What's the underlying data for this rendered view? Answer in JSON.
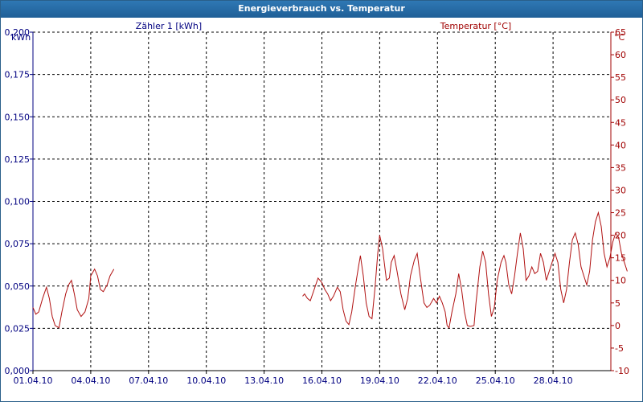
{
  "window": {
    "title": "Energieverbrauch vs. Temperatur"
  },
  "chart_data": {
    "type": "line",
    "title": "Energieverbrauch vs. Temperatur",
    "grid": true,
    "colors": {
      "left_axis": "#000080",
      "right_axis": "#a00000",
      "temperature_line": "#b01010",
      "grid": "#000000"
    },
    "left_axis": {
      "unit": "kWh",
      "series_label": "Zähler 1 [kWh]",
      "range": [
        0,
        0.2
      ],
      "ticks": [
        "0,000",
        "0,025",
        "0,050",
        "0,075",
        "0,100",
        "0,125",
        "0,150",
        "0,175",
        "0,200"
      ]
    },
    "right_axis": {
      "unit": "°C",
      "series_label": "Temperatur [°C]",
      "range": [
        -10,
        65
      ],
      "ticks": [
        "-10",
        "-5",
        "0",
        "5",
        "10",
        "15",
        "20",
        "25",
        "30",
        "35",
        "40",
        "45",
        "50",
        "55",
        "60",
        "65"
      ]
    },
    "x_axis": {
      "range_days": [
        1,
        31
      ],
      "tick_days": [
        1,
        4,
        7,
        10,
        13,
        16,
        19,
        22,
        25,
        28
      ],
      "tick_labels": [
        "01.04.10",
        "04.04.10",
        "07.04.10",
        "10.04.10",
        "13.04.10",
        "16.04.10",
        "19.04.10",
        "22.04.10",
        "25.04.10",
        "28.04.10"
      ]
    },
    "series": [
      {
        "name": "Temperatur [°C]",
        "axis": "right",
        "segments": [
          [
            [
              1.0,
              4
            ],
            [
              1.15,
              2.5
            ],
            [
              1.3,
              3
            ],
            [
              1.5,
              6
            ],
            [
              1.7,
              8.5
            ],
            [
              1.85,
              6
            ],
            [
              2.0,
              2
            ],
            [
              2.15,
              0
            ],
            [
              2.35,
              -0.5
            ],
            [
              2.5,
              3
            ],
            [
              2.7,
              7
            ],
            [
              2.85,
              9
            ],
            [
              3.0,
              10
            ],
            [
              3.15,
              7
            ],
            [
              3.3,
              3.5
            ],
            [
              3.5,
              2
            ],
            [
              3.7,
              3
            ],
            [
              3.9,
              6
            ],
            [
              4.0,
              11
            ],
            [
              4.2,
              12.5
            ],
            [
              4.35,
              11
            ],
            [
              4.5,
              8
            ],
            [
              4.65,
              7.5
            ],
            [
              4.85,
              9
            ],
            [
              5.0,
              11
            ],
            [
              5.2,
              12.5
            ]
          ],
          [
            [
              15.0,
              6.5
            ],
            [
              15.1,
              7
            ],
            [
              15.25,
              6
            ],
            [
              15.4,
              5.5
            ],
            [
              15.6,
              8
            ],
            [
              15.8,
              10.5
            ],
            [
              16.0,
              9.5
            ],
            [
              16.15,
              8
            ],
            [
              16.3,
              7
            ],
            [
              16.45,
              5.5
            ],
            [
              16.6,
              6.5
            ],
            [
              16.8,
              8.5
            ],
            [
              16.95,
              7.5
            ],
            [
              17.1,
              3.5
            ],
            [
              17.25,
              1
            ],
            [
              17.4,
              0.2
            ],
            [
              17.55,
              3
            ],
            [
              17.75,
              9
            ],
            [
              17.9,
              13
            ],
            [
              18.0,
              15.5
            ],
            [
              18.15,
              11
            ],
            [
              18.3,
              5
            ],
            [
              18.45,
              2
            ],
            [
              18.6,
              1.5
            ],
            [
              18.75,
              8
            ],
            [
              18.9,
              16
            ],
            [
              19.0,
              20
            ],
            [
              19.15,
              17
            ],
            [
              19.35,
              10
            ],
            [
              19.5,
              10.5
            ],
            [
              19.6,
              14
            ],
            [
              19.75,
              15.5
            ],
            [
              19.9,
              12
            ],
            [
              20.1,
              7
            ],
            [
              20.3,
              3.5
            ],
            [
              20.45,
              6
            ],
            [
              20.6,
              11
            ],
            [
              20.8,
              14.5
            ],
            [
              20.95,
              16
            ],
            [
              21.1,
              11
            ],
            [
              21.3,
              5
            ],
            [
              21.45,
              4
            ],
            [
              21.6,
              4.5
            ],
            [
              21.8,
              6
            ],
            [
              21.95,
              5
            ],
            [
              22.1,
              6.5
            ],
            [
              22.25,
              5
            ],
            [
              22.4,
              3
            ],
            [
              22.5,
              0
            ],
            [
              22.6,
              -0.5
            ],
            [
              22.75,
              3
            ],
            [
              22.95,
              7
            ],
            [
              23.1,
              11.5
            ],
            [
              23.25,
              8
            ],
            [
              23.4,
              3
            ],
            [
              23.55,
              0
            ],
            [
              23.7,
              -0.2
            ],
            [
              23.9,
              0
            ],
            [
              24.0,
              5
            ],
            [
              24.2,
              13
            ],
            [
              24.35,
              16.5
            ],
            [
              24.5,
              14
            ],
            [
              24.65,
              7
            ],
            [
              24.8,
              2
            ],
            [
              24.95,
              4
            ],
            [
              25.1,
              10
            ],
            [
              25.3,
              14
            ],
            [
              25.45,
              15.5
            ],
            [
              25.55,
              14
            ],
            [
              25.7,
              9
            ],
            [
              25.85,
              7
            ],
            [
              26.0,
              11
            ],
            [
              26.15,
              16
            ],
            [
              26.3,
              20.5
            ],
            [
              26.45,
              17
            ],
            [
              26.6,
              10
            ],
            [
              26.75,
              11
            ],
            [
              26.9,
              13
            ],
            [
              27.05,
              11.5
            ],
            [
              27.2,
              12
            ],
            [
              27.35,
              16
            ],
            [
              27.5,
              14
            ],
            [
              27.65,
              10
            ],
            [
              27.8,
              12
            ],
            [
              27.95,
              14
            ],
            [
              28.1,
              16
            ],
            [
              28.25,
              14
            ],
            [
              28.4,
              8
            ],
            [
              28.55,
              5
            ],
            [
              28.7,
              8
            ],
            [
              28.85,
              14
            ],
            [
              29.0,
              19
            ],
            [
              29.15,
              20.5
            ],
            [
              29.3,
              18
            ],
            [
              29.45,
              13
            ],
            [
              29.6,
              11
            ],
            [
              29.75,
              9
            ],
            [
              29.9,
              12
            ],
            [
              30.05,
              19
            ],
            [
              30.2,
              23
            ],
            [
              30.35,
              25
            ],
            [
              30.5,
              22
            ],
            [
              30.65,
              16
            ],
            [
              30.8,
              13
            ],
            [
              30.95,
              15
            ],
            [
              31.1,
              18.5
            ],
            [
              31.25,
              20.5
            ],
            [
              31.4,
              19.5
            ],
            [
              31.55,
              16
            ],
            [
              31.7,
              14
            ],
            [
              31.85,
              12
            ]
          ]
        ]
      }
    ]
  }
}
